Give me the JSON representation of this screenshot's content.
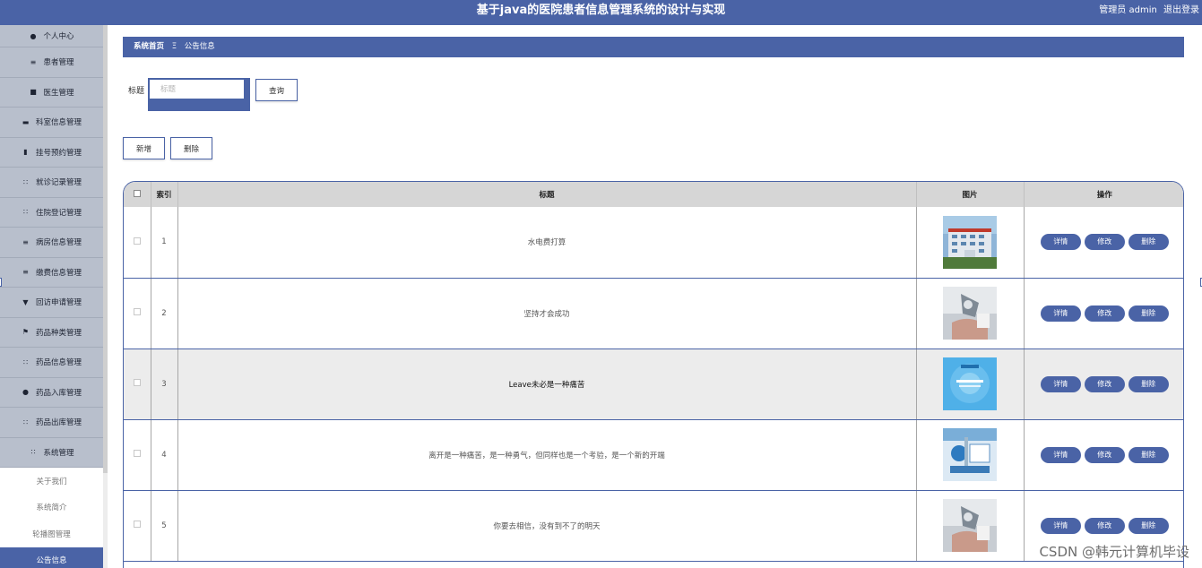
{
  "header": {
    "title": "基于java的医院患者信息管理系统的设计与实现",
    "user_label": "管理员 admin",
    "logout_label": "退出登录"
  },
  "sidebar": {
    "items": [
      {
        "label": "个人中心",
        "icon": "person-icon"
      },
      {
        "label": "患者管理",
        "icon": "sliders-icon"
      },
      {
        "label": "医生管理",
        "icon": "thumb-icon"
      },
      {
        "label": "科室信息管理",
        "icon": "briefcase-icon"
      },
      {
        "label": "挂号预约管理",
        "icon": "chart-icon"
      },
      {
        "label": "就诊记录管理",
        "icon": "grid-icon"
      },
      {
        "label": "住院登记管理",
        "icon": "grid-icon"
      },
      {
        "label": "病房信息管理",
        "icon": "list-icon"
      },
      {
        "label": "缴费信息管理",
        "icon": "list-icon"
      },
      {
        "label": "回访申请管理",
        "icon": "trophy-icon"
      },
      {
        "label": "药品种类管理",
        "icon": "flag-icon"
      },
      {
        "label": "药品信息管理",
        "icon": "grid-icon"
      },
      {
        "label": "药品入库管理",
        "icon": "person-icon"
      },
      {
        "label": "药品出库管理",
        "icon": "grid-icon"
      },
      {
        "label": "系统管理",
        "icon": "grid-icon"
      }
    ],
    "sub_items": [
      {
        "label": "关于我们",
        "active": false
      },
      {
        "label": "系统简介",
        "active": false
      },
      {
        "label": "轮播图管理",
        "active": false
      },
      {
        "label": "公告信息",
        "active": true
      }
    ]
  },
  "breadcrumb": {
    "home": "系统首页",
    "separator": "Ξ",
    "current": "公告信息"
  },
  "search": {
    "label": "标题",
    "placeholder": "标题",
    "query_button": "查询"
  },
  "toolbar": {
    "add_label": "新增",
    "delete_label": "删除"
  },
  "table": {
    "columns": [
      "索引",
      "标题",
      "图片",
      "操作"
    ],
    "actions": {
      "detail": "详情",
      "edit": "修改",
      "delete": "删除"
    },
    "rows": [
      {
        "index": "1",
        "title": "水电费打算",
        "image": "hospital-building",
        "highlight": false
      },
      {
        "index": "2",
        "title": "坚持才会成功",
        "image": "medical-robot",
        "highlight": false
      },
      {
        "index": "3",
        "title": "Leave未必是一种痛苦",
        "image": "blue-presentation",
        "highlight": true
      },
      {
        "index": "4",
        "title": "离开是一种痛苦，是一种勇气，但同样也是一个考验，是一个新的开端",
        "image": "medical-equipment",
        "highlight": false
      },
      {
        "index": "5",
        "title": "你要去相信，没有到不了的明天",
        "image": "medical-robot",
        "highlight": false
      }
    ]
  },
  "watermark": "CSDN @韩元计算机毕设",
  "colors": {
    "primary": "#4a63a6",
    "sidebar_bg": "#b8bfcc",
    "header_row": "#d6d6d6",
    "highlight_row": "#ececec"
  }
}
